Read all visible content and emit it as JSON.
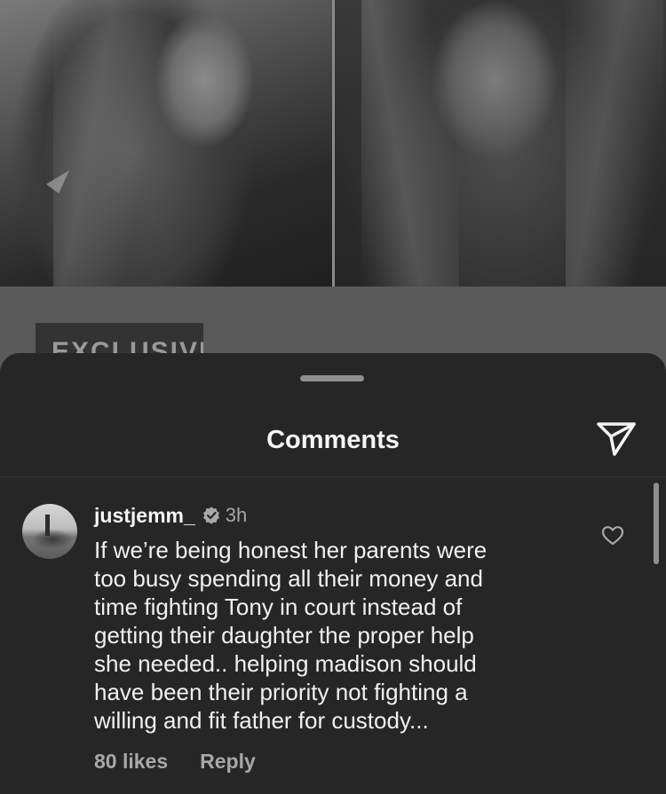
{
  "post": {
    "tag": "EXCLUSIVE",
    "images": [
      {
        "icon": "photo-woman-portrait-left"
      },
      {
        "icon": "photo-woman-portrait-right"
      }
    ]
  },
  "comments_sheet": {
    "title": "Comments",
    "share_icon": "paper-plane-icon"
  },
  "comments": [
    {
      "username": "justjemm_",
      "verified": true,
      "time": "3h",
      "text": "If we’re being honest her parents were too busy spending all their money and time fighting Tony in court instead of getting their daughter the proper help she needed.. helping madison should have been their priority not fighting a willing and fit father for custody...",
      "lines": [
        "If we’re being honest her parents were",
        "too busy spending all their money and",
        "time fighting Tony in court instead of",
        "getting their daughter the proper help",
        "she needed.. helping madison should",
        "have been their priority not fighting a",
        "willing and fit father for custody..."
      ],
      "likes": "80 likes",
      "reply_label": "Reply",
      "like_icon": "heart-outline-icon"
    }
  ],
  "colors": {
    "sheet_bg": "#262626",
    "text_primary": "#f5f5f5",
    "text_secondary": "#a8a8a8"
  }
}
